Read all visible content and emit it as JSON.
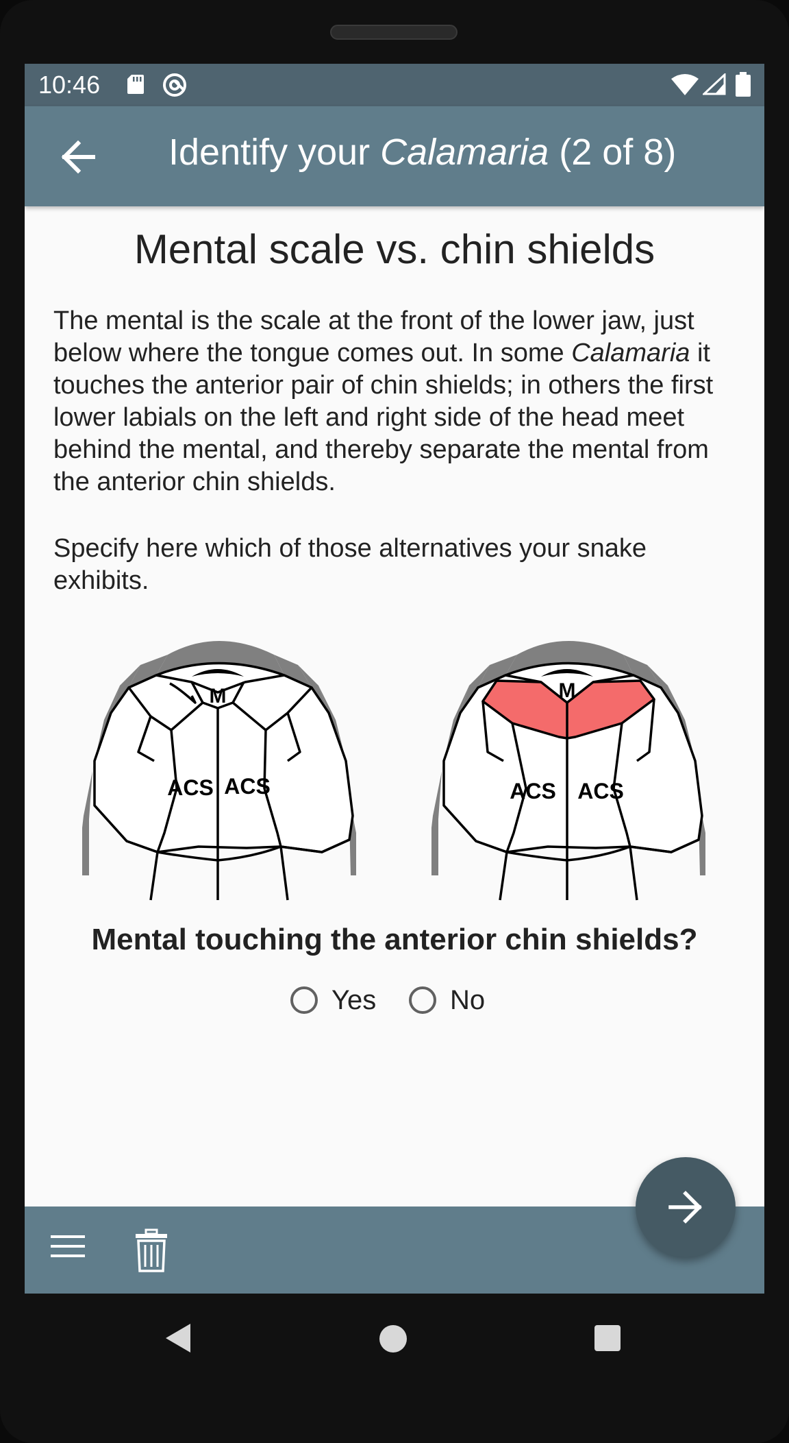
{
  "status_bar": {
    "time": "10:46"
  },
  "app_bar": {
    "title_prefix": "Identify your ",
    "title_genus": "Calamaria",
    "title_suffix": " (2 of 8)"
  },
  "content": {
    "heading": "Mental scale vs. chin shields",
    "paragraph1_part1": "The mental is the scale at the front of the lower jaw, just below where the tongue comes out. In some ",
    "paragraph1_genus": "Calamaria",
    "paragraph1_part2": " it touches the anterior pair of chin shields; in others the first lower labials on the left and right side of the head meet behind the mental, and thereby separate the mental from the anterior chin shields.",
    "paragraph2": "Specify here which of those alternatives your snake exhibits.",
    "diagram_labels": {
      "mental": "M",
      "chin_shield": "ACS"
    },
    "question": "Mental touching the anterior chin shields?",
    "options": [
      {
        "label": "Yes",
        "selected": false
      },
      {
        "label": "No",
        "selected": false
      }
    ]
  },
  "colors": {
    "status_bar": "#4f6470",
    "app_bar": "#607d8b",
    "fab": "#455a64",
    "highlight": "#f46b6b",
    "scale_gray": "#808080"
  },
  "icons": {
    "app_bar": "back-arrow-icon",
    "bottom_bar": [
      "menu-icon",
      "trash-icon"
    ],
    "fab": "forward-arrow-icon"
  }
}
